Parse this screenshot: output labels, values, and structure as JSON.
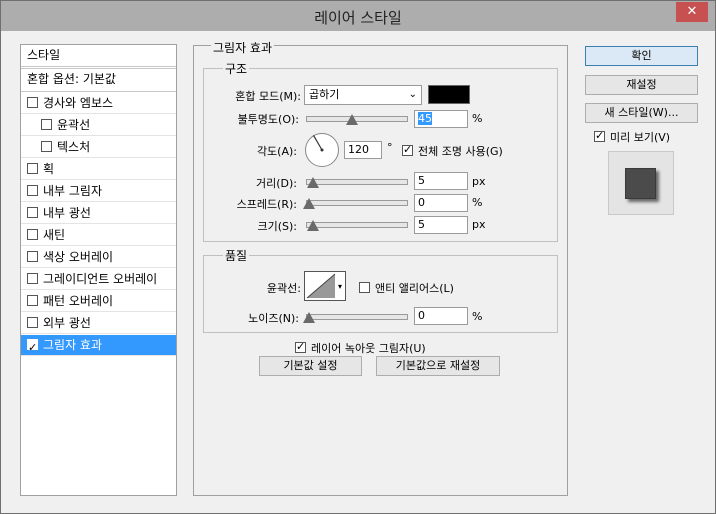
{
  "window": {
    "title": "레이어 스타일",
    "close_icon": "close-icon"
  },
  "style_list": {
    "header": "스타일",
    "blend_options": "혼합 옵션: 기본값",
    "items": [
      {
        "label": "경사와 엠보스",
        "checked": false,
        "sub": false,
        "selected": false
      },
      {
        "label": "윤곽선",
        "checked": false,
        "sub": true,
        "selected": false
      },
      {
        "label": "텍스처",
        "checked": false,
        "sub": true,
        "selected": false
      },
      {
        "label": "획",
        "checked": false,
        "sub": false,
        "selected": false
      },
      {
        "label": "내부 그림자",
        "checked": false,
        "sub": false,
        "selected": false
      },
      {
        "label": "내부 광선",
        "checked": false,
        "sub": false,
        "selected": false
      },
      {
        "label": "새틴",
        "checked": false,
        "sub": false,
        "selected": false
      },
      {
        "label": "색상 오버레이",
        "checked": false,
        "sub": false,
        "selected": false
      },
      {
        "label": "그레이디언트 오버레이",
        "checked": false,
        "sub": false,
        "selected": false
      },
      {
        "label": "패턴 오버레이",
        "checked": false,
        "sub": false,
        "selected": false
      },
      {
        "label": "외부 광선",
        "checked": false,
        "sub": false,
        "selected": false
      },
      {
        "label": "그림자 효과",
        "checked": true,
        "sub": false,
        "selected": true
      }
    ]
  },
  "drop_shadow": {
    "title": "그림자 효과",
    "structure": {
      "title": "구조",
      "blend_mode_label": "혼합 모드(M):",
      "blend_mode_value": "곱하기",
      "shadow_color": "#000000",
      "opacity_label": "불투명도(O):",
      "opacity_value": "45",
      "opacity_fraction": 0.45,
      "opacity_unit": "%",
      "angle_label": "각도(A):",
      "angle_value": "120",
      "angle_unit": "°",
      "global_light_label": "전체 조명 사용(G)",
      "global_light_checked": true,
      "distance_label": "거리(D):",
      "distance_value": "5",
      "distance_unit": "px",
      "spread_label": "스프레드(R):",
      "spread_value": "0",
      "spread_unit": "%",
      "size_label": "크기(S):",
      "size_value": "5",
      "size_unit": "px"
    },
    "quality": {
      "title": "품질",
      "contour_label": "윤곽선:",
      "antialias_label": "앤티 앨리어스(L)",
      "antialias_checked": false,
      "noise_label": "노이즈(N):",
      "noise_value": "0",
      "noise_unit": "%"
    },
    "knockout_label": "레이어 녹아웃 그림자(U)",
    "knockout_checked": true,
    "make_default_label": "기본값 설정",
    "reset_default_label": "기본값으로 재설정"
  },
  "right": {
    "ok_label": "확인",
    "reset_label": "재설정",
    "new_style_label": "새 스타일(W)...",
    "preview_label": "미리 보기(V)",
    "preview_checked": true
  }
}
